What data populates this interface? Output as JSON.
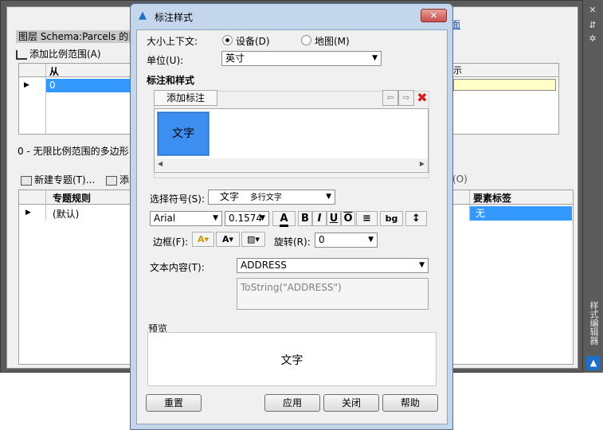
{
  "background": {
    "layer_label": "图层 Schema:Parcels 的比",
    "add_scale_range": "添加比例范围(A)",
    "link_fragment": "面",
    "top_grid": {
      "header": "从",
      "row_value": "0",
      "right_header_fragment": "示"
    },
    "description": "0 - 无限比例范围的多边形",
    "new_theme": "新建专题(T)...",
    "add_fragment": "添",
    "o_fragment": "(O)",
    "bottom_grid": {
      "header": "专题规则",
      "row_value": "(默认)",
      "right_header": "要素标签",
      "right_value": "无"
    },
    "side_title": "样式编辑器"
  },
  "dialog": {
    "title": "标注样式",
    "close_label": "✕",
    "context_label": "大小上下文:",
    "context_options": [
      {
        "label": "设备(D)",
        "selected": true
      },
      {
        "label": "地图(M)",
        "selected": false
      }
    ],
    "unit_label": "单位(U):",
    "unit_value": "英寸",
    "section_title": "标注和样式",
    "add_label_button": "添加标注",
    "label_tile_text": "文字",
    "symbol_label": "选择符号(S):",
    "symbol_value": "文字",
    "symbol_subvalue": "多行文字",
    "font_value": "Arial",
    "font_size_value": "0.1574",
    "format_buttons": [
      "A",
      "B",
      "I",
      "U",
      "O",
      "≡",
      "bg",
      "↕"
    ],
    "border_label": "边框(F):",
    "rotation_label": "旋转(R):",
    "rotation_value": "0",
    "text_content_label": "文本内容(T):",
    "text_content_value": "ADDRESS",
    "expression_value": "ToString(\"ADDRESS\")",
    "preview_label": "预览",
    "preview_text": "文字",
    "buttons": {
      "reset": "重置",
      "apply": "应用",
      "close": "关闭",
      "help": "帮助"
    }
  }
}
